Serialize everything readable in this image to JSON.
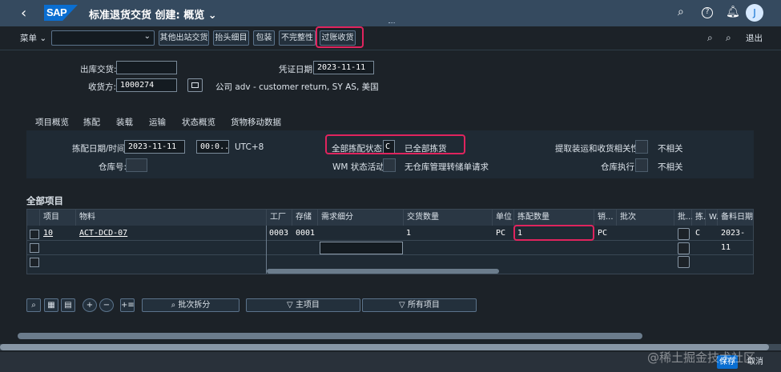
{
  "shell": {
    "title": "标准退货交货 创建: 概览",
    "logo": "SAP",
    "avatar": "J"
  },
  "toolbar": {
    "menu_label": "菜单",
    "buttons": [
      "其他出站交货",
      "抬头细目",
      "包装",
      "不完整性",
      "过账收货"
    ],
    "exit_label": "退出"
  },
  "header": {
    "outbound_delivery_label": "出库交货:",
    "outbound_delivery_value": "",
    "doc_date_label": "凭证日期:",
    "doc_date_value": "2023-11-11",
    "ship_to_label": "收货方:",
    "ship_to_value": "1000274",
    "ship_to_desc": "公司 adv - customer return, SY AS, 美国"
  },
  "tabs": [
    "项目概览",
    "拣配",
    "装载",
    "运输",
    "状态概览",
    "货物移动数据"
  ],
  "picking": {
    "pick_date_label": "拣配日期/时间:",
    "pick_date_value": "2023-11-11",
    "pick_time_value": "00:0..",
    "timezone": "UTC+8",
    "warehouse_label": "仓库号:",
    "overall_status_label": "全部拣配状态:",
    "overall_status_code": "C",
    "overall_status_text": "已全部拣货",
    "wm_status_label": "WM 状态活动:",
    "wm_status_text": "无仓库管理转储单请求",
    "relevance_label": "提取装运和收货相关性:",
    "relevance_text": "不相关",
    "wh_exec_label": "仓库执行:",
    "wh_exec_text": "不相关"
  },
  "items": {
    "title": "全部项目",
    "columns": [
      "项目",
      "物料",
      "工厂",
      "存储",
      "需求细分",
      "交货数量",
      "单位",
      "拣配数量",
      "销...",
      "批次",
      "批...",
      "拣...",
      "W...",
      "备料日期"
    ],
    "rows": [
      {
        "item": "10",
        "material": "ACT-DCD-07",
        "plant": "0003",
        "sloc": "0001",
        "req_seg": "",
        "qty": "1",
        "unit": "PC",
        "pick_qty": "1",
        "sales_unit": "PC",
        "batch": "",
        "pick_status": "C",
        "date": "2023-11"
      }
    ]
  },
  "bottom": {
    "batch_split": "批次拆分",
    "main_items": "主项目",
    "all_items": "所有项目"
  },
  "footer": {
    "save": "保存",
    "cancel": "取消",
    "watermark": "@稀土掘金技术社区"
  }
}
